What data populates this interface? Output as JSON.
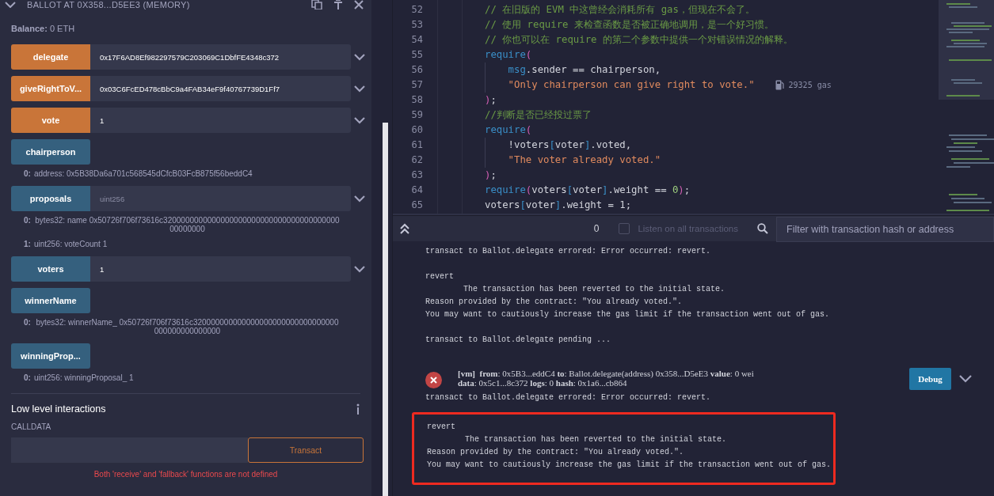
{
  "contract_panel": {
    "title": "BALLOT AT 0X358...D5EE3 (MEMORY)",
    "balance_label": "Balance:",
    "balance": "0 ETH",
    "functions": [
      {
        "kind": "transact",
        "label": "delegate",
        "value": "0x17F6AD8Ef982297579C203069C1DbfFE4348c372"
      },
      {
        "kind": "transact",
        "label": "giveRightToV...",
        "value": "0x03C6FcED478cBbC9a4FAB34eF9f40767739D1Ff7"
      },
      {
        "kind": "transact",
        "label": "vote",
        "value": "1"
      },
      {
        "kind": "call",
        "label": "chairperson",
        "outputs": [
          {
            "index": "0:",
            "text": "address: 0x5B38Da6a701c568545dCfcB03FcB875f56beddC4"
          }
        ]
      },
      {
        "kind": "call",
        "label": "proposals",
        "placeholder": "uint256",
        "outputs": [
          {
            "index": "0:",
            "text": "bytes32: name 0x50726f706f73616c320000000000000000000000000000000000000000000000"
          },
          {
            "index": "1:",
            "text": "uint256: voteCount 1"
          }
        ]
      },
      {
        "kind": "call",
        "label": "voters",
        "value": "1"
      },
      {
        "kind": "call",
        "label": "winnerName",
        "outputs": [
          {
            "index": "0:",
            "text": "bytes32: winnerName_ 0x50726f706f73616c320000000000000000000000000000000000000000000000"
          }
        ]
      },
      {
        "kind": "call",
        "label": "winningProp...",
        "outputs": [
          {
            "index": "0:",
            "text": "uint256: winningProposal_ 1"
          }
        ]
      }
    ],
    "low_level": {
      "title": "Low level interactions",
      "calldata_label": "CALLDATA",
      "button": "Transact",
      "error": "Both 'receive' and 'fallback' functions are not defined"
    }
  },
  "editor": {
    "lines": [
      {
        "number": "52",
        "tokens": [
          {
            "kind": "comment",
            "text": "// 在旧版的 EVM 中这曾经会消耗所有 gas，但现在不会了。"
          }
        ]
      },
      {
        "number": "53",
        "tokens": [
          {
            "kind": "comment",
            "text": "// 使用 require 来检查函数是否被正确地调用，是一个好习惯。"
          }
        ]
      },
      {
        "number": "54",
        "tokens": [
          {
            "kind": "comment",
            "text": "// 你也可以在 require 的第二个参数中提供一个对错误情况的解释。"
          }
        ]
      },
      {
        "number": "55",
        "tokens": [
          {
            "kind": "fn",
            "text": "require"
          },
          {
            "kind": "paren",
            "text": "("
          }
        ]
      },
      {
        "number": "56",
        "tokens": [
          {
            "kind": "indent"
          },
          {
            "kind": "fn",
            "text": "msg"
          },
          {
            "kind": "plain",
            "text": ".sender == chairperson,"
          }
        ]
      },
      {
        "number": "57",
        "tokens": [
          {
            "kind": "indent"
          },
          {
            "kind": "string",
            "text": "\"Only chairperson can give right to vote.\""
          }
        ],
        "gas": "29325 gas"
      },
      {
        "number": "58",
        "tokens": [
          {
            "kind": "paren",
            "text": ")"
          },
          {
            "kind": "plain",
            "text": ";"
          }
        ]
      },
      {
        "number": "59",
        "tokens": [
          {
            "kind": "comment",
            "text": "//判断是否已经投过票了"
          }
        ]
      },
      {
        "number": "60",
        "tokens": [
          {
            "kind": "fn",
            "text": "require"
          },
          {
            "kind": "paren",
            "text": "("
          }
        ]
      },
      {
        "number": "61",
        "tokens": [
          {
            "kind": "indent"
          },
          {
            "kind": "plain",
            "text": "!voters"
          },
          {
            "kind": "bracket",
            "text": "["
          },
          {
            "kind": "plain",
            "text": "voter"
          },
          {
            "kind": "bracket",
            "text": "]"
          },
          {
            "kind": "plain",
            "text": ".voted,"
          }
        ]
      },
      {
        "number": "62",
        "tokens": [
          {
            "kind": "indent"
          },
          {
            "kind": "string",
            "text": "\"The voter already voted.\""
          }
        ]
      },
      {
        "number": "63",
        "tokens": [
          {
            "kind": "paren",
            "text": ")"
          },
          {
            "kind": "plain",
            "text": ";"
          }
        ]
      },
      {
        "number": "64",
        "tokens": [
          {
            "kind": "fn",
            "text": "require"
          },
          {
            "kind": "paren",
            "text": "("
          },
          {
            "kind": "plain",
            "text": "voters"
          },
          {
            "kind": "bracket",
            "text": "["
          },
          {
            "kind": "plain",
            "text": "voter"
          },
          {
            "kind": "bracket",
            "text": "]"
          },
          {
            "kind": "plain",
            "text": ".weight == "
          },
          {
            "kind": "number",
            "text": "0"
          },
          {
            "kind": "paren",
            "text": ")"
          },
          {
            "kind": "plain",
            "text": ";"
          }
        ]
      },
      {
        "number": "65",
        "tokens": [
          {
            "kind": "plain",
            "text": "voters"
          },
          {
            "kind": "bracket",
            "text": "["
          },
          {
            "kind": "plain",
            "text": "voter"
          },
          {
            "kind": "bracket",
            "text": "]"
          },
          {
            "kind": "plain",
            "text": ".weight = 1;"
          }
        ]
      }
    ]
  },
  "terminal": {
    "count": "0",
    "listen": {
      "label": "Listen on all transactions",
      "checked": false
    },
    "filter_placeholder": "Filter with transaction hash or address",
    "log": [
      {
        "kind": "text",
        "lines": [
          "transact to Ballot.delegate errored: Error occurred: revert."
        ]
      },
      {
        "kind": "revert",
        "highlighted": false,
        "lines": [
          "revert",
          "The transaction has been reverted to the initial state.",
          "Reason provided by the contract: \"You already voted.\".",
          "You may want to cautiously increase the gas limit if the transaction went out of gas."
        ]
      },
      {
        "kind": "text",
        "lines": [
          "transact to Ballot.delegate pending ..."
        ]
      },
      {
        "kind": "tx",
        "failed": true,
        "lines": [
          "**[vm]**  **from**: 0x5B3...eddC4 **to**: Ballot.delegate(address) 0x358...D5eE3 **value**: 0 wei",
          "**data**: 0x5c1...8c372 **logs**: 0 **hash**: 0x1a6...cb864"
        ],
        "button": "Debug"
      },
      {
        "kind": "text",
        "lines": [
          "transact to Ballot.delegate errored: Error occurred: revert."
        ]
      },
      {
        "kind": "revert",
        "highlighted": true,
        "lines": [
          "revert",
          "The transaction has been reverted to the initial state.",
          "Reason provided by the contract: \"You already voted.\".",
          "You may want to cautiously increase the gas limit if the transaction went out of gas."
        ]
      }
    ]
  }
}
